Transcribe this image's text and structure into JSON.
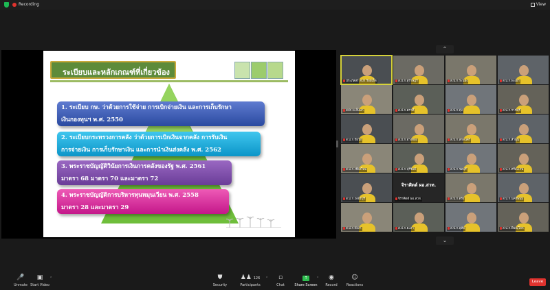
{
  "top": {
    "recording": "Recording",
    "view": "View"
  },
  "slide": {
    "title": "ระเบียบและหลักเกณฑ์ที่เกี่ยวข้อง",
    "items": [
      {
        "line1": "1. ระเบียบ กษ. ว่าด้วยการใช้จ่าย การเบิกจ่ายเงิน และการเก็บรักษา",
        "line2": "เงินกองทุนฯ พ.ศ. 2550"
      },
      {
        "line1": "2. ระเบียบกระทรวงการคลัง ว่าด้วยการเบิกเงินจากคลัง การรับเงิน",
        "line2": "การจ่ายเงิน การเก็บรักษาเงิน และการนำเงินส่งคลัง พ.ศ. 2562"
      },
      {
        "line1": "3. พระราชบัญญัติวินัยการเงินการคลังของรัฐ พ.ศ. 2561",
        "line2": "มาตรา 68 มาตรา 70 และมาตรา 72"
      },
      {
        "line1": "4. พระราชบัญญัติการบริหารทุนหมุนเวียน พ.ศ. 2558",
        "line2": "มาตรา 28 และมาตรา 29"
      }
    ],
    "colors": {
      "title_bg": "#5d8b3a",
      "item1": "#3656b0",
      "item2": "#1aa9dc",
      "item3": "#7c4cac",
      "item4": "#d6299c"
    }
  },
  "gallery": {
    "tiles": [
      {
        "name": "ประภัสสร สปก.ร้อยเอ็ด"
      },
      {
        "name": "ส.ป.ก.สุราษฎร์"
      },
      {
        "name": "ส.ป.ก.ระนอง"
      },
      {
        "name": "ส.ป.ก.พะเยา"
      },
      {
        "name": "สปก.พ.ลั้นนา"
      },
      {
        "name": "ส.ป.ก.ตราดี"
      },
      {
        "name": "ส.ป.ก.ทุ่ง"
      },
      {
        "name": "ส.ป.ก.ราชบุรี"
      },
      {
        "name": "ส.ป.ก.ขิงไผ่"
      },
      {
        "name": "ส.ป.ก.อ่างทอง"
      },
      {
        "name": "ส.ป.ก.สกลนคร"
      },
      {
        "name": "ส.ป.ก.ลำพูน"
      },
      {
        "name": "ส.ป.ก.เชียงใหม่"
      },
      {
        "name": "ส.ป.ก.บุรีรัมย์"
      },
      {
        "name": "ส.ป.ก.ชลบุรี"
      },
      {
        "name": "ส.ป.ก.ศรีสะเกษ"
      },
      {
        "name": "ส.ป.ก.เพชรบุรี"
      },
      {
        "name": "จิราศิตต์ ผอ.สวท.",
        "big": "จิราศิตต์ ผอ.สวท."
      },
      {
        "name": "ส.ป.ก.ตรัง"
      },
      {
        "name": "ส.ป.ก.นครพนม"
      },
      {
        "name": "ส.ป.ก.พังงา"
      },
      {
        "name": "ส.ป.ก.ยะลา"
      },
      {
        "name": "ส.ป.ก.อุทัย"
      },
      {
        "name": "ส.ป.ก.พิษณุโลก"
      }
    ]
  },
  "toolbar": {
    "unmute": "Unmute",
    "start_video": "Start Video",
    "security": "Security",
    "participants": "Participants",
    "participants_count": "126",
    "chat": "Chat",
    "share_screen": "Share Screen",
    "record": "Record",
    "reactions": "Reactions",
    "leave": "Leave"
  }
}
